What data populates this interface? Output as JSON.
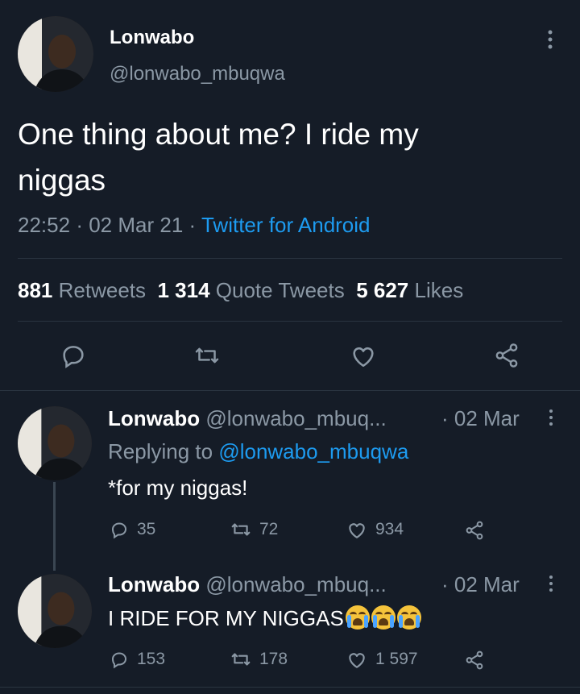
{
  "main_tweet": {
    "author_name": "Lonwabo",
    "author_handle": "@lonwabo_mbuqwa",
    "text_line1": "One thing about me? I ride my",
    "text_line2": "niggas",
    "time": "22:52",
    "date": "02 Mar 21",
    "source": "Twitter for Android",
    "separator": "·"
  },
  "stats": {
    "retweets_count": "881",
    "retweets_label": "Retweets",
    "quotes_count": "1 314",
    "quotes_label": "Quote Tweets",
    "likes_count": "5 627",
    "likes_label": "Likes"
  },
  "replies": [
    {
      "author_name": "Lonwabo",
      "author_handle": "@lonwabo_mbuq...",
      "date": "· 02 Mar",
      "replying_prefix": "Replying to",
      "replying_handle": "@lonwabo_mbuqwa",
      "text": "*for my niggas!",
      "reply_count": "35",
      "retweet_count": "72",
      "like_count": "934"
    },
    {
      "author_name": "Lonwabo",
      "author_handle": "@lonwabo_mbuq...",
      "date": "· 02 Mar",
      "text": "I RIDE FOR MY NIGGAS",
      "reply_count": "153",
      "retweet_count": "178",
      "like_count": "1 597"
    }
  ],
  "icons": {
    "more": "more-vertical-icon",
    "reply": "reply-icon",
    "retweet": "retweet-icon",
    "like": "heart-icon",
    "share": "share-icon",
    "emoji": "crying-face-emoji"
  },
  "colors": {
    "background": "#151c27",
    "accent": "#1d9bf0",
    "muted": "#8b98a5"
  }
}
